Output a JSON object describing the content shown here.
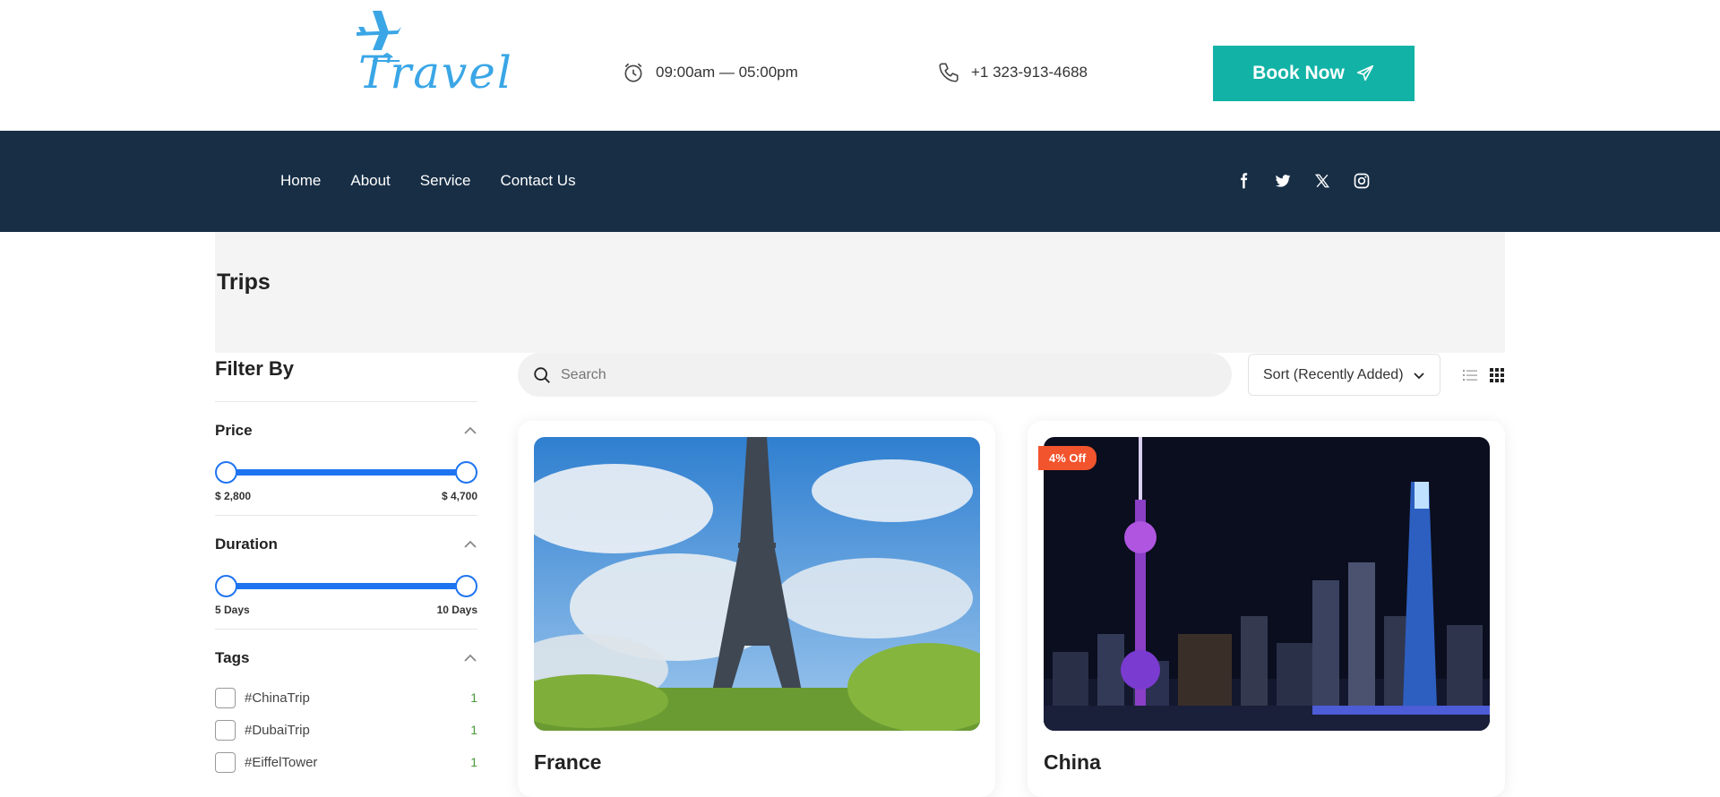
{
  "header": {
    "logo_text": "Travel",
    "hours": "09:00am — 05:00pm",
    "phone": "+1 323-913-4688",
    "book_label": "Book Now"
  },
  "nav": {
    "items": [
      "Home",
      "About",
      "Service",
      "Contact Us"
    ]
  },
  "social": [
    "facebook-icon",
    "twitter-icon",
    "x-icon",
    "instagram-icon"
  ],
  "page": {
    "title": "Trips"
  },
  "filters": {
    "title": "Filter By",
    "price": {
      "label": "Price",
      "min_label": "$ 2,800",
      "max_label": "$ 4,700"
    },
    "duration": {
      "label": "Duration",
      "min_label": "5 Days",
      "max_label": "10 Days"
    },
    "tags": {
      "label": "Tags",
      "items": [
        {
          "name": "#ChinaTrip",
          "count": "1"
        },
        {
          "name": "#DubaiTrip",
          "count": "1"
        },
        {
          "name": "#EiffelTower",
          "count": "1"
        }
      ]
    }
  },
  "toolbar": {
    "search_placeholder": "Search",
    "sort_label": "Sort (Recently Added)"
  },
  "trips": [
    {
      "name": "France",
      "badge": ""
    },
    {
      "name": "China",
      "badge": "4% Off"
    }
  ],
  "colors": {
    "accent": "#12b3a6",
    "navbar": "#172e45",
    "slider": "#1e74f0",
    "badge": "#f2542d",
    "logo": "#3aa6e6"
  }
}
